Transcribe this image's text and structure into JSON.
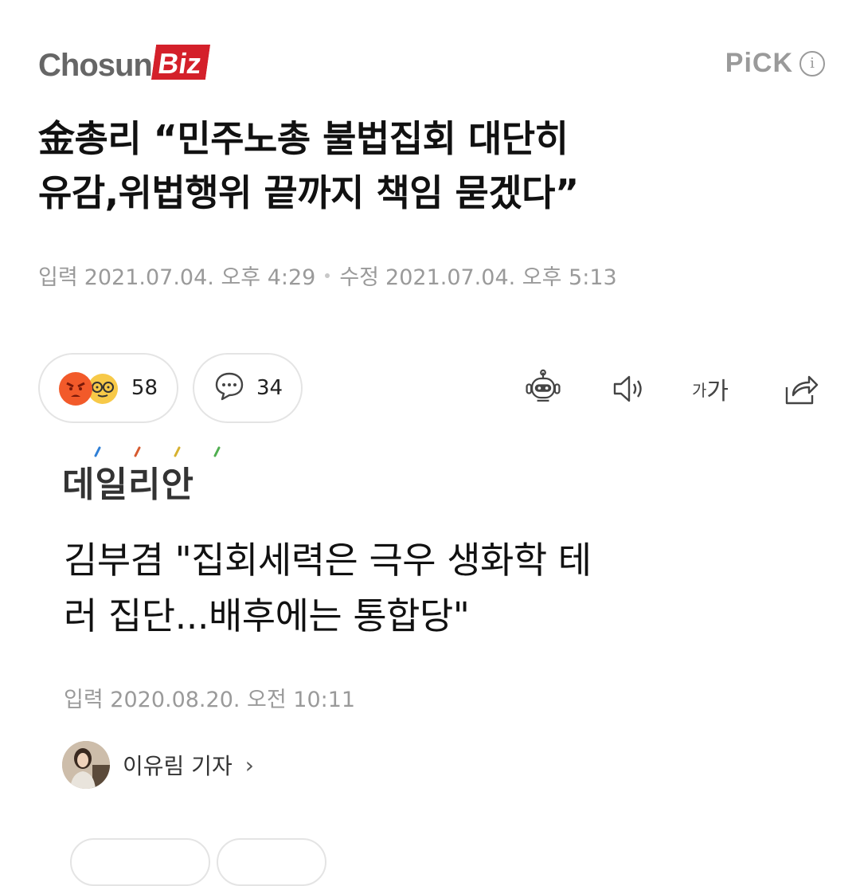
{
  "article1": {
    "publisher_logo": {
      "part1": "Chosun",
      "part2": "Biz"
    },
    "pick_label": "PiCK",
    "info_glyph": "i",
    "headline_line1": "金총리 “민주노총 불법집회 대단히",
    "headline_line2": "유감,위법행위 끝까지 책임 묻겠다”",
    "input_label": "입력",
    "input_time": "2021.07.04. 오후 4:29",
    "edit_label": "수정",
    "edit_time": "2021.07.04. 오후 5:13",
    "reaction_count": "58",
    "comment_count": "34",
    "font_size_label_small": "가",
    "font_size_label_large": "가"
  },
  "article2": {
    "publisher_logo": "데일리안",
    "headline_line1": "김부겸 \"집회세력은 극우 생화학 테",
    "headline_line2": "러 집단...배후에는 통합당\"",
    "input_label": "입력",
    "input_time": "2020.08.20. 오전 10:11",
    "author_name": "이유림 기자",
    "author_chevron": "›"
  },
  "colors": {
    "brand_red": "#d4202a",
    "muted_gray": "#9a9a9a",
    "border_gray": "#e4e4e4"
  },
  "icons": [
    "angry-emoji-icon",
    "nerd-emoji-icon",
    "comment-bubble-icon",
    "robot-icon",
    "speaker-icon",
    "font-size-icon",
    "share-icon",
    "avatar"
  ]
}
